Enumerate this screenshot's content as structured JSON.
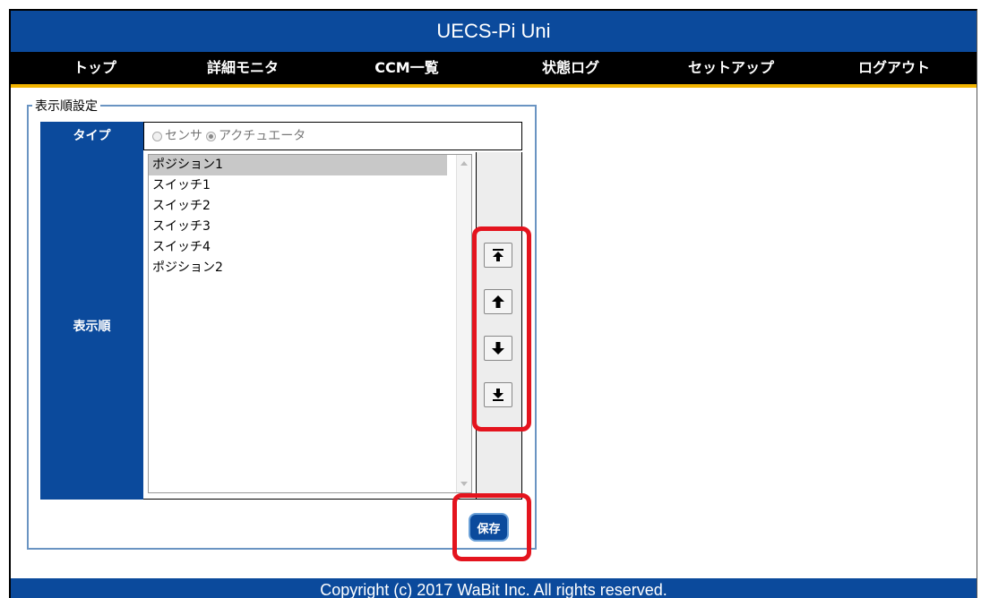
{
  "app": {
    "title": "UECS-Pi Uni"
  },
  "nav": {
    "items": [
      {
        "label": "トップ"
      },
      {
        "label": "詳細モニタ"
      },
      {
        "label": "CCM一覧"
      },
      {
        "label": "状態ログ"
      },
      {
        "label": "セットアップ"
      },
      {
        "label": "ログアウト"
      }
    ]
  },
  "settings": {
    "legend": "表示順設定",
    "type_label": "タイプ",
    "type_options": [
      {
        "label": "センサ",
        "checked": false
      },
      {
        "label": "アクチュエータ",
        "checked": true
      }
    ],
    "order_label": "表示順",
    "list_items": [
      {
        "label": "ポジション1",
        "selected": true
      },
      {
        "label": "スイッチ1",
        "selected": false
      },
      {
        "label": "スイッチ2",
        "selected": false
      },
      {
        "label": "スイッチ3",
        "selected": false
      },
      {
        "label": "スイッチ4",
        "selected": false
      },
      {
        "label": "ポジション2",
        "selected": false
      }
    ],
    "move_buttons": [
      {
        "icon": "move-to-top-icon"
      },
      {
        "icon": "move-up-icon"
      },
      {
        "icon": "move-down-icon"
      },
      {
        "icon": "move-to-bottom-icon"
      }
    ],
    "save_label": "保存"
  },
  "footer": {
    "copyright": "Copyright (c) 2017 WaBit Inc. All rights reserved."
  },
  "colors": {
    "brand": "#0b4a9c",
    "accent": "#f2b400",
    "highlight": "#e4141e"
  }
}
